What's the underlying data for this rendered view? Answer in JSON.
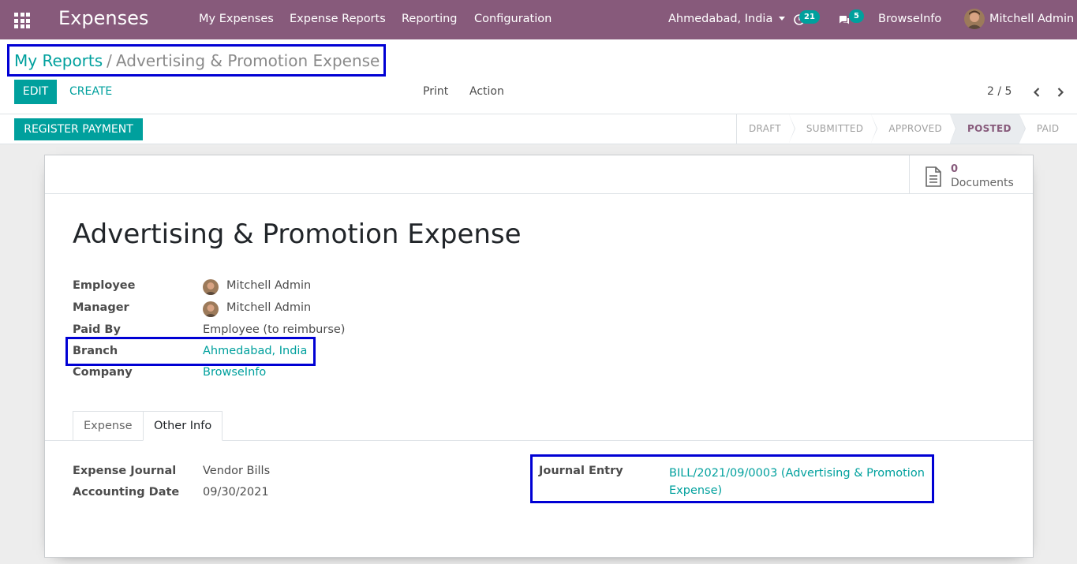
{
  "navbar": {
    "app_name": "Expenses",
    "menus": [
      "My Expenses",
      "Expense Reports",
      "Reporting",
      "Configuration"
    ],
    "branch_selector": "Ahmedabad, India",
    "activity_count": "21",
    "message_count": "5",
    "company": "BrowseInfo",
    "user": "Mitchell Admin"
  },
  "breadcrumb": {
    "parent": "My Reports",
    "separator": "/",
    "current": "Advertising & Promotion Expense"
  },
  "buttons": {
    "edit": "EDIT",
    "create": "CREATE",
    "print": "Print",
    "action": "Action",
    "register_payment": "REGISTER PAYMENT"
  },
  "pager": {
    "text": "2 / 5"
  },
  "status_steps": [
    "DRAFT",
    "SUBMITTED",
    "APPROVED",
    "POSTED",
    "PAID"
  ],
  "active_status": "POSTED",
  "smart_button": {
    "count": "0",
    "label": "Documents"
  },
  "form": {
    "title": "Advertising & Promotion Expense",
    "employee_label": "Employee",
    "employee_value": "Mitchell Admin",
    "manager_label": "Manager",
    "manager_value": "Mitchell Admin",
    "paid_by_label": "Paid By",
    "paid_by_value": "Employee (to reimburse)",
    "branch_label": "Branch",
    "branch_value": "Ahmedabad, India",
    "company_label": "Company",
    "company_value": "BrowseInfo"
  },
  "tabs": [
    "Expense",
    "Other Info"
  ],
  "active_tab": "Other Info",
  "other_info": {
    "journal_label": "Expense Journal",
    "journal_value": "Vendor Bills",
    "date_label": "Accounting Date",
    "date_value": "09/30/2021",
    "entry_label": "Journal Entry",
    "entry_value_line1": "BILL/2021/09/0003 (Advertising & Promotion",
    "entry_value_line2": "Expense)"
  },
  "colors": {
    "navbar": "#875a7b",
    "accent": "#00a09d",
    "highlight_box": "#0000d4"
  }
}
